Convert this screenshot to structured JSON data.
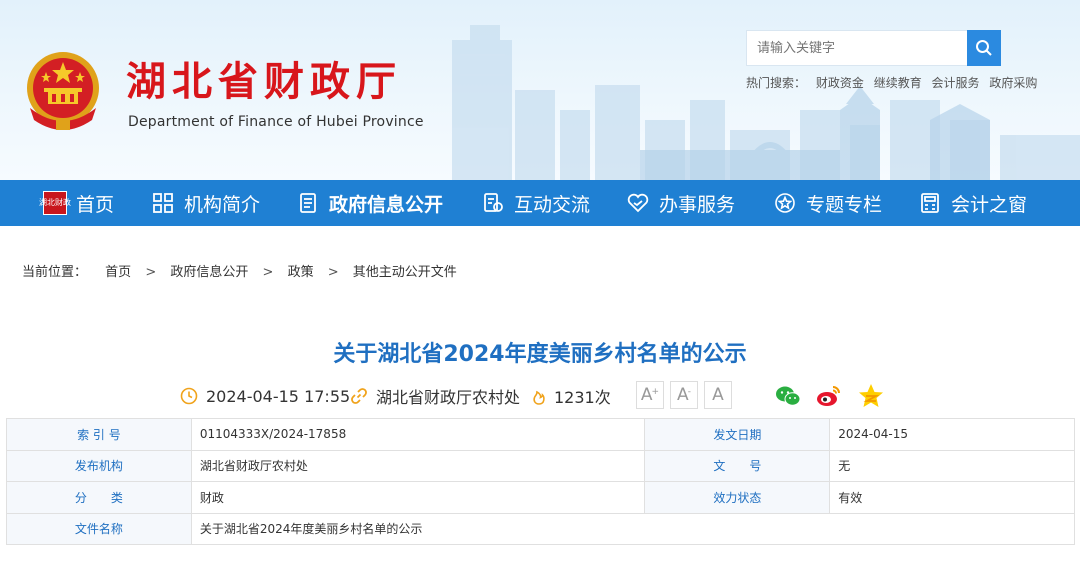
{
  "header": {
    "title": "湖北省财政厅",
    "subtitle": "Department of Finance of Hubei Province",
    "emblem_icon": "national-emblem-icon",
    "search": {
      "placeholder": "请输入关键字"
    },
    "hot_search": {
      "label": "热门搜索：",
      "items": [
        "财政资金",
        "继续教育",
        "会计服务",
        "政府采购"
      ]
    }
  },
  "nav": {
    "items": [
      {
        "label": "首页",
        "icon": "home-logo-icon"
      },
      {
        "label": "机构简介",
        "icon": "grid-icon"
      },
      {
        "label": "政府信息公开",
        "icon": "document-icon",
        "active": true
      },
      {
        "label": "互动交流",
        "icon": "chat-doc-icon"
      },
      {
        "label": "办事服务",
        "icon": "heart-icon"
      },
      {
        "label": "专题专栏",
        "icon": "star-circle-icon"
      },
      {
        "label": "会计之窗",
        "icon": "calculator-icon"
      }
    ],
    "home_logo_text": "湖北财政"
  },
  "breadcrumb": {
    "label": "当前位置：",
    "items": [
      "首页",
      "政府信息公开",
      "政策",
      "其他主动公开文件"
    ],
    "separator": ">"
  },
  "article": {
    "title": "关于湖北省2024年度美丽乡村名单的公示",
    "datetime": "2024-04-15 17:55",
    "source": "湖北省财政厅农村处",
    "views": "1231次",
    "font_sizes": [
      "A",
      "A",
      "A"
    ],
    "share_icons": [
      "wechat-icon",
      "weibo-icon",
      "qzone-icon"
    ]
  },
  "info_table": {
    "rows": [
      [
        {
          "label": "索 引 号",
          "value": "01104333X/2024-17858"
        },
        {
          "label": "发文日期",
          "value": "2024-04-15"
        }
      ],
      [
        {
          "label": "发布机构",
          "value": "湖北省财政厅农村处"
        },
        {
          "label": "文　　号",
          "value": "无"
        }
      ],
      [
        {
          "label": "分　　类",
          "value": "财政"
        },
        {
          "label": "效力状态",
          "value": "有效"
        }
      ],
      [
        {
          "label": "文件名称",
          "value": "关于湖北省2024年度美丽乡村名单的公示"
        }
      ]
    ]
  },
  "colors": {
    "brand_red": "#d8161b",
    "nav_blue": "#1f80d3",
    "title_blue": "#1f6fc1",
    "search_blue": "#2b8ae0"
  }
}
